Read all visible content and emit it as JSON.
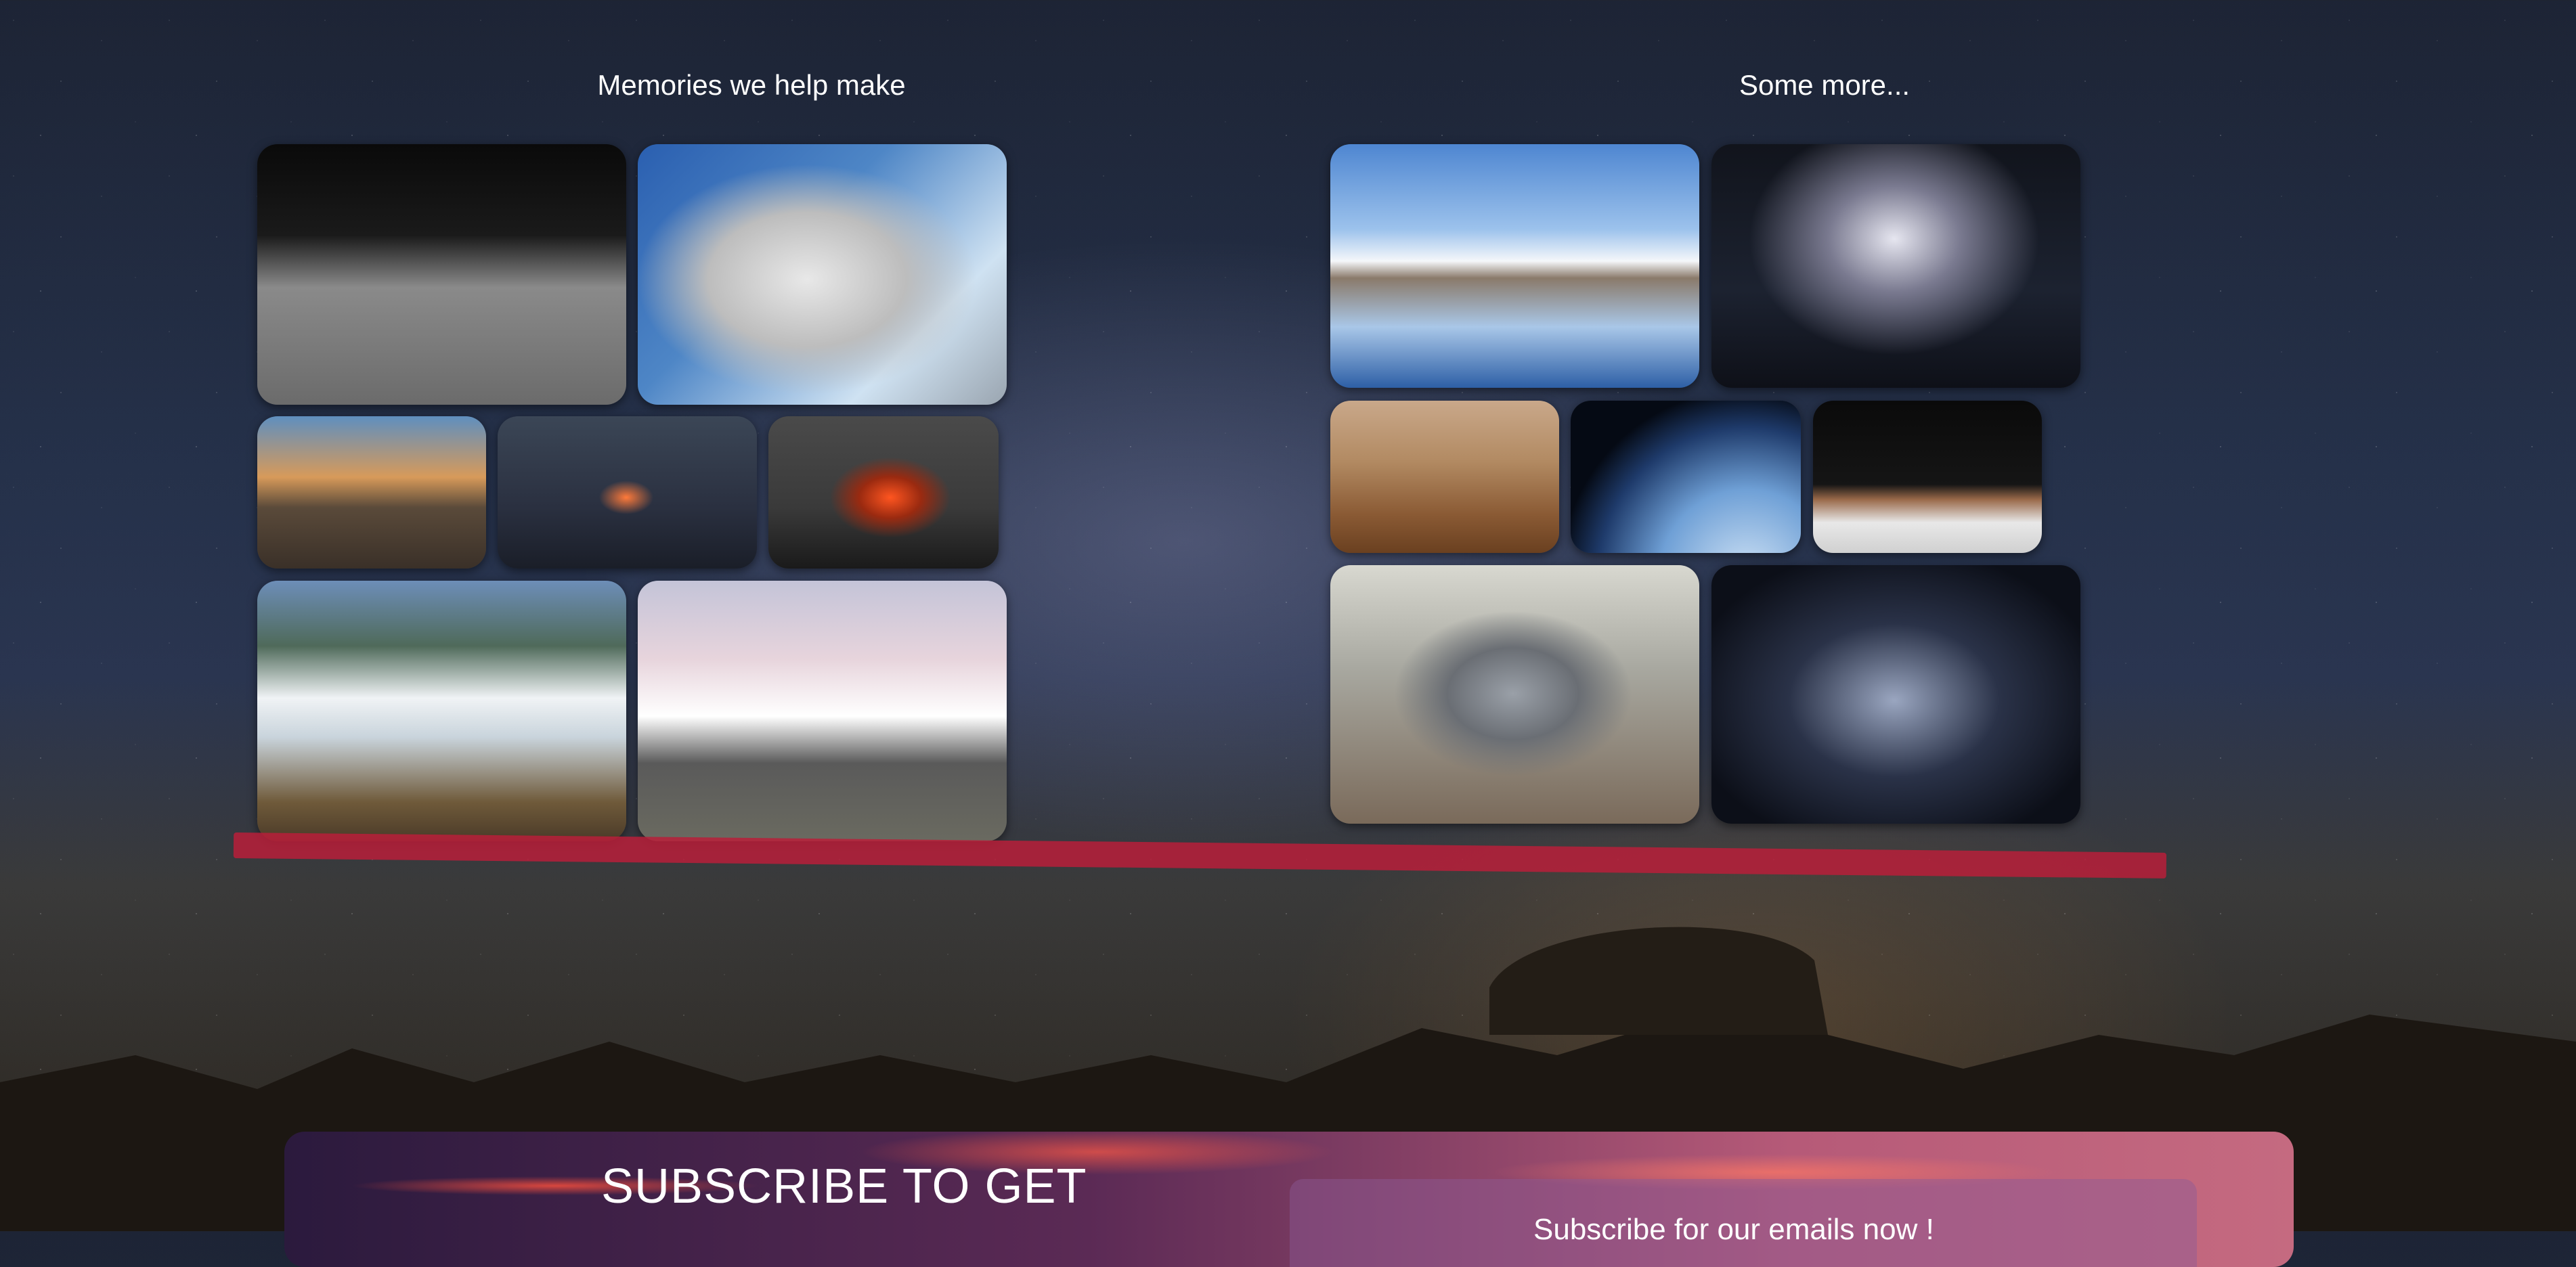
{
  "gallery_left": {
    "title": "Memories we help make",
    "images": [
      {
        "icon": "moon-landing-photo"
      },
      {
        "icon": "astronaut-spacewalk-photo"
      },
      {
        "icon": "volcano-sunrise-photo"
      },
      {
        "icon": "volcano-lava-night-photo"
      },
      {
        "icon": "volcano-eruption-photo"
      },
      {
        "icon": "volcano-clouds-photo"
      },
      {
        "icon": "snowy-volcano-lake-photo"
      }
    ]
  },
  "gallery_right": {
    "title": "Some more...",
    "images": [
      {
        "icon": "snowy-mountain-reflection-photo"
      },
      {
        "icon": "lightning-island-photo"
      },
      {
        "icon": "mars-rover-photo"
      },
      {
        "icon": "spacecraft-earth-photo"
      },
      {
        "icon": "person-reaching-photo"
      },
      {
        "icon": "armored-cosplay-photo"
      },
      {
        "icon": "light-installation-photo"
      }
    ]
  },
  "subscribe": {
    "heading": "SUBSCRIBE TO GET",
    "subtext": "Subscribe for our emails now !"
  },
  "colors": {
    "accent_line": "#b81f3a"
  }
}
